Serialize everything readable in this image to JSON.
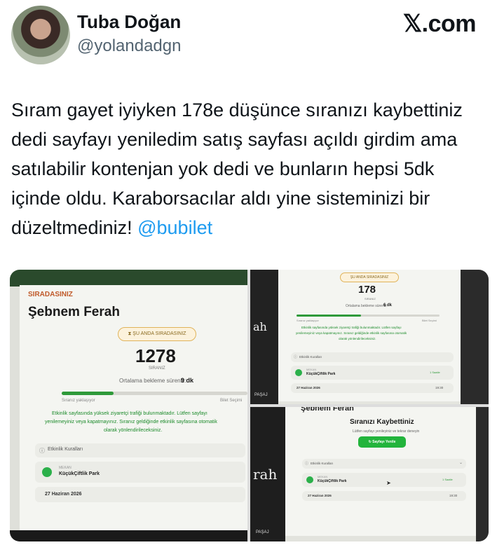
{
  "author": {
    "name": "Tuba Doğan",
    "handle": "@yolandadgn"
  },
  "brand": {
    "label": "𝕏.com"
  },
  "tweet": {
    "text": "Sıram gayet iyiyken 178e düşünce sıranızı kaybettiniz dedi sayfayı yeniledim satış sayfası açıldı girdim ama satılabilir kontenjan yok dedi ve bunların hepsi 5dk içinde oldu. Karaborsacılar aldı yine sisteminizi bir düzeltmediniz!",
    "mention": "@bubilet"
  },
  "photo1": {
    "header": "SIRADASINIZ",
    "title": "Şebnem Ferah",
    "status_pill": "ŞU ANDA SIRADASINIZ",
    "queue_number": "1278",
    "queue_caption": "SIRANIZ",
    "wait_label": "Ortalama bekleme süreniz:",
    "wait_value": "9 dk",
    "progress_left": "Sıranız yaklaşıyor",
    "progress_right": "Bilet Seçimi",
    "progress": 0.28,
    "notice_line1": "Etkinlik sayfasında yüksek ziyaretçi trafiği bulunmaktadır. Lütfen sayfayı",
    "notice_line2": "yenilemeyiniz veya kapatmayınız. Sıranız geldiğinde etkinlik sayfasına otomatik",
    "notice_line3": "olarak yönlendirileceksiniz.",
    "rules_label": "Etkinlik Kuralları",
    "venue_caption": "MEKAN",
    "venue_name": "KüçükÇiftlik Park",
    "date": "27 Haziran 2026"
  },
  "photo2": {
    "status_pill": "ŞU ANDA SIRADASINIZ",
    "queue_number": "178",
    "queue_caption": "SIRANIZ",
    "wait_label": "Ortalama bekleme süreniz:",
    "wait_value": "6 dk",
    "progress_left": "Sıranız yaklaşıyor",
    "progress_right": "Bilet Seçimi",
    "progress": 0.45,
    "notice_line1": "Etkinlik sayfasında yüksek ziyaretçi trafiği bulunmaktadır. Lütfen sayfayı",
    "notice_line2": "yenilemeyiniz veya kapatmayınız. Sıranız geldiğinde etkinlik sayfasına otomatik",
    "notice_line3": "olarak yönlendirileceksiniz.",
    "side_text": "ah",
    "rules_label": "Etkinlik Kuralları",
    "venue_caption": "MEKAN",
    "venue_name": "KüçükÇiftlik Park",
    "venue_link": "1 Saatle",
    "date": "27 Haziran 2026",
    "time": "19:30",
    "footer_text": "PAŞAJ"
  },
  "photo3": {
    "top_title": "Şebnem Ferah",
    "title": "Sıranızı Kaybettiniz",
    "subtitle": "Lütfen sayfayı yenileyiniz ve tekrar deneyin",
    "button_label": "Sayfayı Yenile",
    "side_text": "rah",
    "rules_label": "Etkinlik Kuralları",
    "venue_caption": "MEKAN",
    "venue_name": "KüçükÇiftlik Park",
    "venue_link": "1 Saatle",
    "date": "27 Haziran 2026",
    "time": "19:30",
    "footer_text": "PAŞAJ"
  },
  "colors": {
    "accent_green": "#22b43c",
    "link_blue": "#1d9bf0",
    "pill_amber": "#e0b35a"
  }
}
